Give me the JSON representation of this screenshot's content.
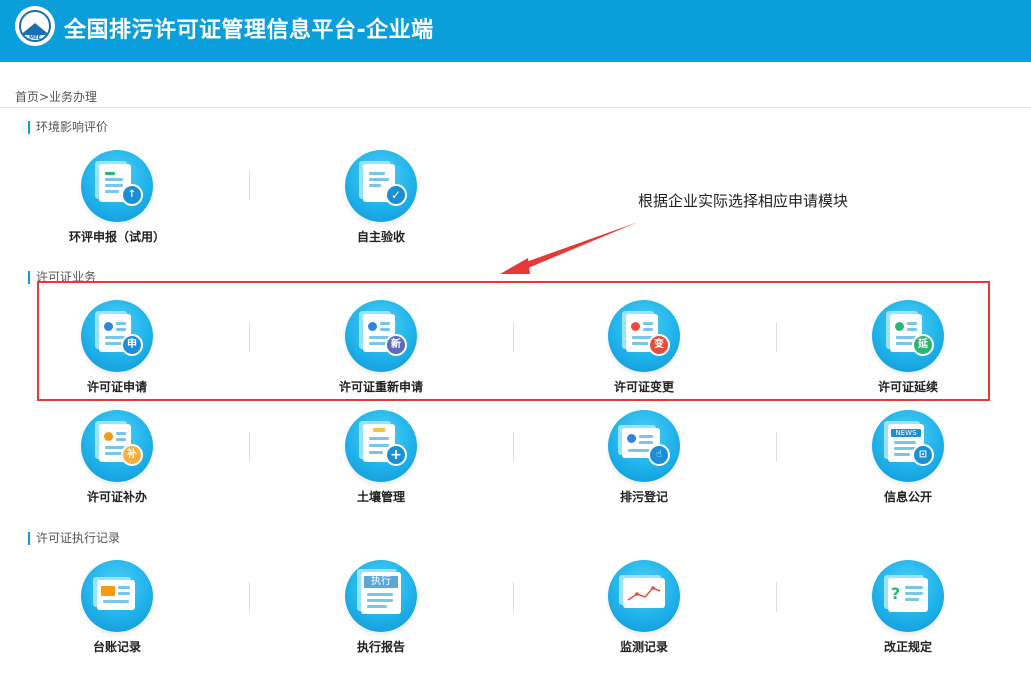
{
  "header": {
    "title": "全国排污许可证管理信息平台-企业端",
    "logo_text": "MEE"
  },
  "breadcrumb": "首页>业务办理",
  "sections": {
    "eia": "环境影响评价",
    "permit": "许可证业务",
    "execution": "许可证执行记录"
  },
  "tiles": {
    "eia_report": {
      "label": "环评申报（试用）",
      "icon": "upload-doc-icon",
      "badge": ""
    },
    "self_check": {
      "label": "自主验收",
      "icon": "checklist-icon",
      "badge": ""
    },
    "apply": {
      "label": "许可证申请",
      "icon": "certificate-icon",
      "badge": "申"
    },
    "reapply": {
      "label": "许可证重新申请",
      "icon": "certificate-icon",
      "badge": "新"
    },
    "change": {
      "label": "许可证变更",
      "icon": "certificate-icon",
      "badge": "变"
    },
    "renew": {
      "label": "许可证延续",
      "icon": "certificate-icon",
      "badge": "延"
    },
    "supplement": {
      "label": "许可证补办",
      "icon": "certificate-icon",
      "badge": "补"
    },
    "soil": {
      "label": "土壤管理",
      "icon": "clipboard-icon",
      "badge": "+"
    },
    "register": {
      "label": "排污登记",
      "icon": "id-card-icon",
      "badge": ""
    },
    "info": {
      "label": "信息公开",
      "icon": "news-icon",
      "badge": ""
    },
    "ledger": {
      "label": "台账记录",
      "icon": "ledger-icon",
      "badge": ""
    },
    "exec_report": {
      "label": "执行报告",
      "icon": "exec-report-icon",
      "badge": "执行"
    },
    "monitor": {
      "label": "监测记录",
      "icon": "monitor-chart-icon",
      "badge": ""
    },
    "rectify": {
      "label": "改正规定",
      "icon": "question-doc-icon",
      "badge": "?"
    },
    "news_text": "NEWS"
  },
  "annotation": "根据企业实际选择相应申请模块",
  "colors": {
    "header": "#0a9fdb",
    "highlight": "#e53935",
    "arrow": "#e53935"
  }
}
